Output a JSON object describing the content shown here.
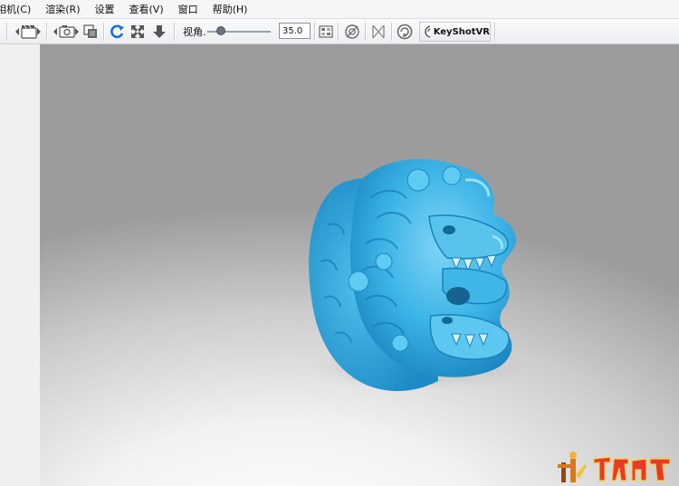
{
  "menu": [
    {
      "label": "相机(C)"
    },
    {
      "label": "渲染(R)"
    },
    {
      "label": "设置"
    },
    {
      "label": "查看(V)"
    },
    {
      "label": "窗口"
    },
    {
      "label": "帮助(H)"
    }
  ],
  "toolbar": {
    "fov_label": "视角.",
    "fov_value": "35.0",
    "vr_label": "KeyShotVR",
    "icons": [
      "camera-prev-icon",
      "film-camera-icon",
      "camera-next-icon",
      "screenshot-icon",
      "render-region-icon",
      "refresh-icon",
      "fit-view-icon",
      "drop-down-icon",
      "tone-icon",
      "lighting-icon",
      "geometry-view-icon",
      "keyshot-logo-icon"
    ]
  },
  "viewport": {
    "model": "jade-lion-head-model",
    "model_color": "#3cb4e6"
  },
  "watermark": {
    "text": "木工爱好者"
  }
}
